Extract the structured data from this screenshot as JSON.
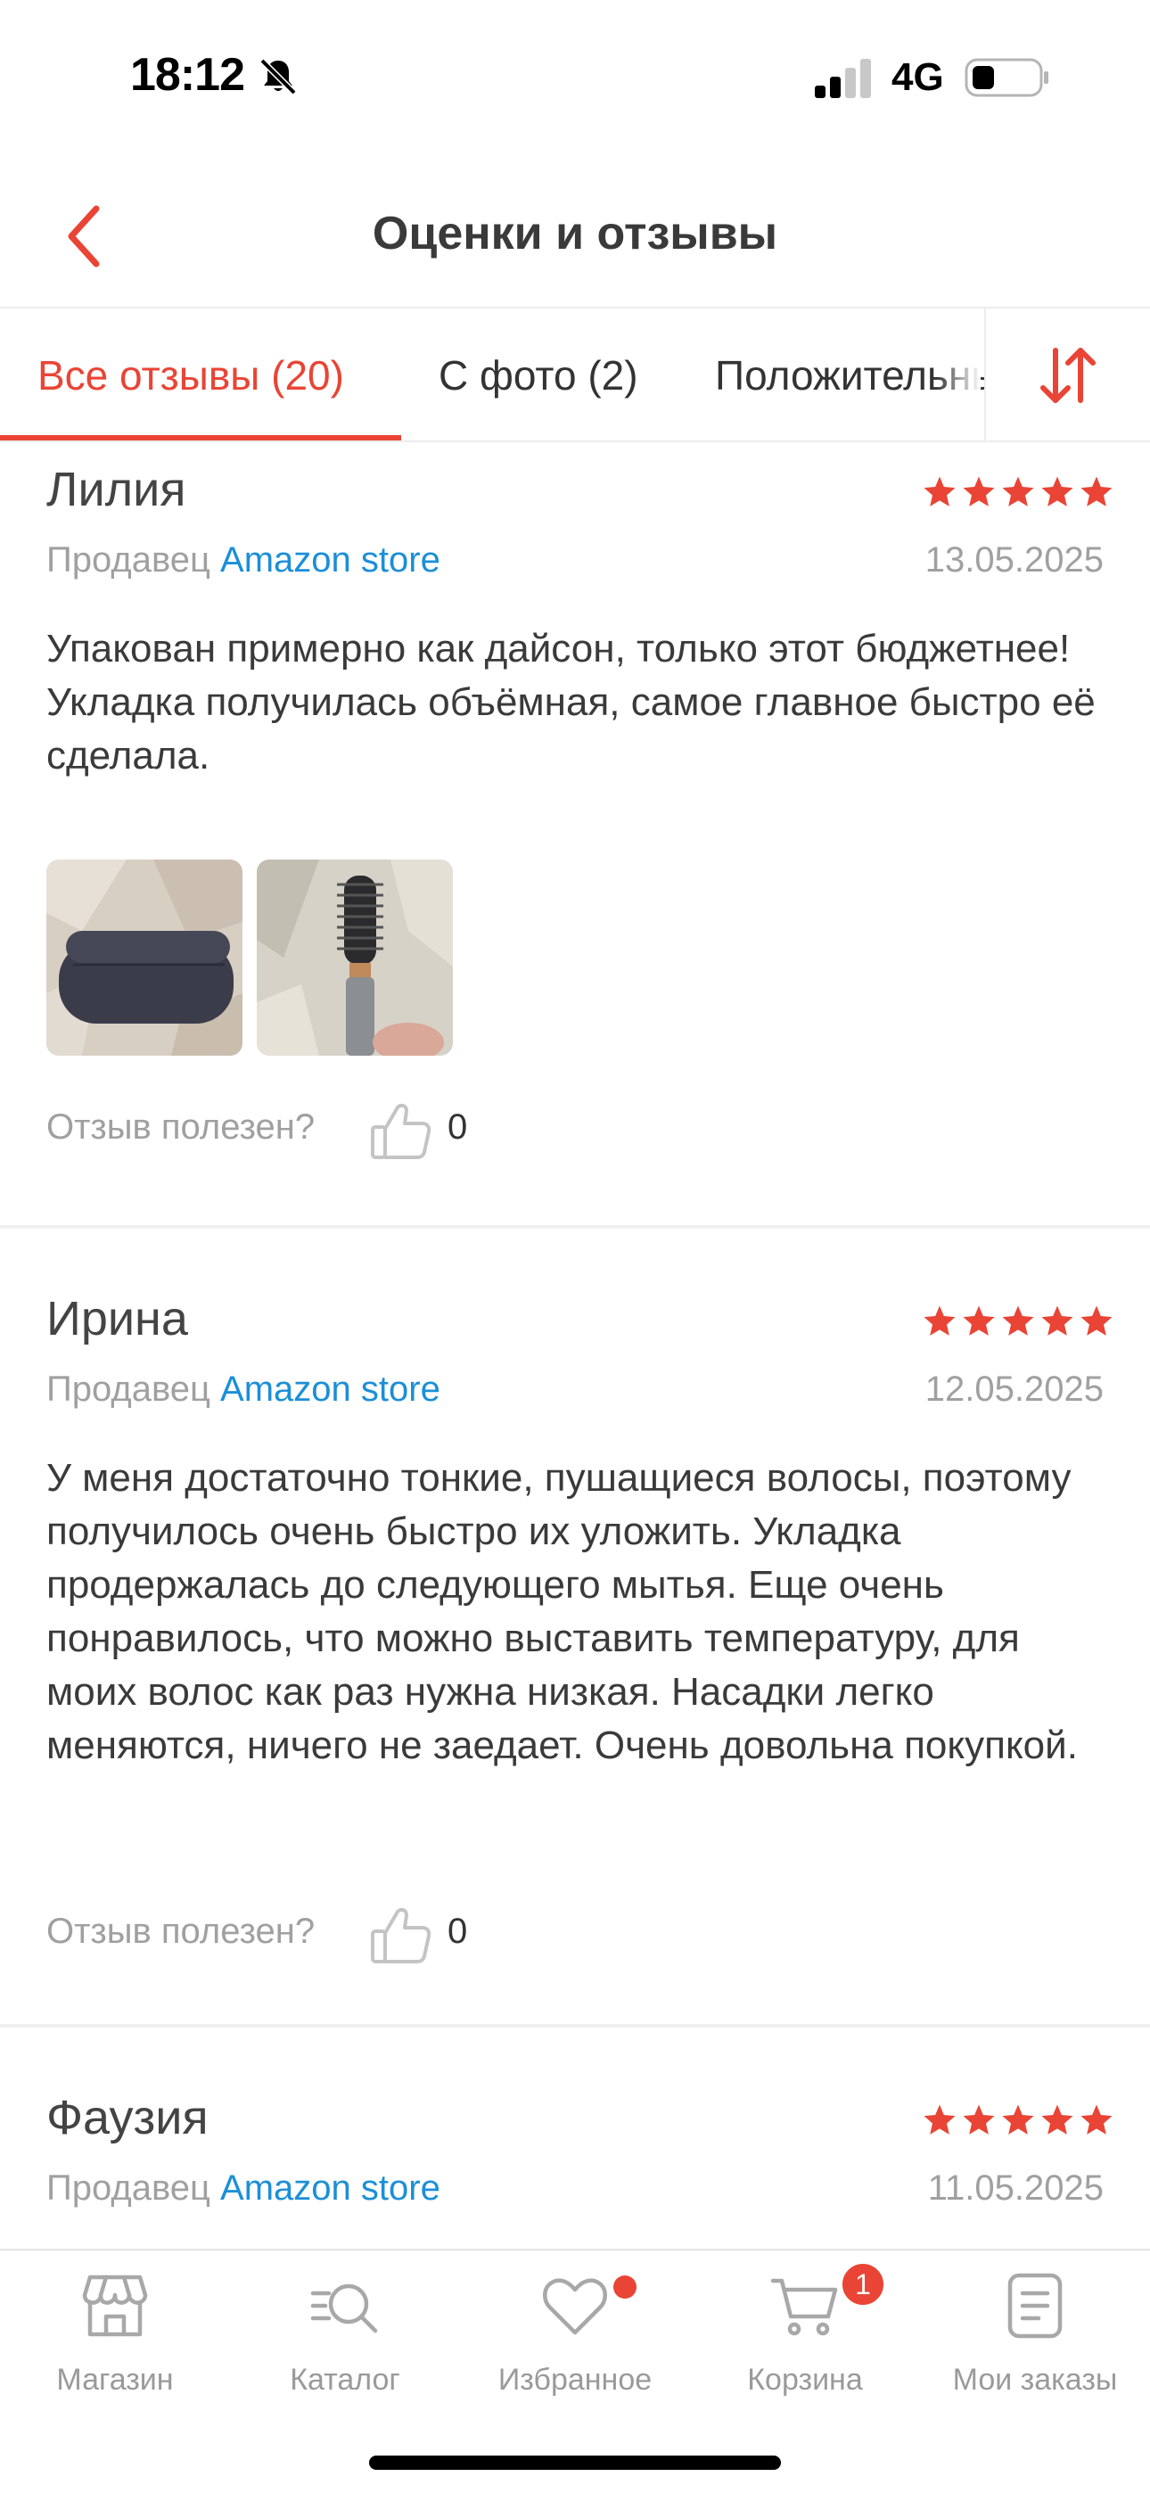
{
  "status": {
    "time": "18:12",
    "network": "4G"
  },
  "header": {
    "title": "Оценки и отзывы"
  },
  "tabs": [
    {
      "label": "Все отзывы (20)",
      "active": true
    },
    {
      "label": "С фото (2)",
      "active": false
    },
    {
      "label": "Положительные",
      "active": false
    }
  ],
  "reviews": [
    {
      "author": "Лилия",
      "rating": 5,
      "seller_prefix": "Продавец",
      "seller_name": "Amazon store",
      "date": "13.05.2025",
      "text": "Упакован примерно как дайсон, только этот бюджетнее! Укладка получилась объёмная, самое главное быстро её сделала.",
      "helpful_label": "Отзыв полезен?",
      "helpful_count": "0"
    },
    {
      "author": "Ирина",
      "rating": 5,
      "seller_prefix": "Продавец",
      "seller_name": "Amazon store",
      "date": "12.05.2025",
      "text": "У меня достаточно тонкие, пушащиеся волосы, поэтому получилось очень быстро их уложить. Укладка продержалась до следующего мытья. Еще очень понравилось, что можно выставить температуру, для моих волос как раз нужна низкая. Насадки легко меняются, ничего не заедает. Очень довольна покупкой.",
      "helpful_label": "Отзыв полезен?",
      "helpful_count": "0"
    },
    {
      "author": "Фаузия",
      "rating": 5,
      "seller_prefix": "Продавец",
      "seller_name": "Amazon store",
      "date": "11.05.2025"
    }
  ],
  "bottom_nav": [
    {
      "label": "Магазин",
      "icon": "store-icon"
    },
    {
      "label": "Каталог",
      "icon": "catalog-search-icon"
    },
    {
      "label": "Избранное",
      "icon": "heart-icon"
    },
    {
      "label": "Корзина",
      "icon": "cart-icon",
      "badge": "1"
    },
    {
      "label": "Мои заказы",
      "icon": "orders-icon"
    }
  ],
  "colors": {
    "accent": "#e94435",
    "link": "#1b8fd8",
    "muted": "#a0a0a0"
  }
}
